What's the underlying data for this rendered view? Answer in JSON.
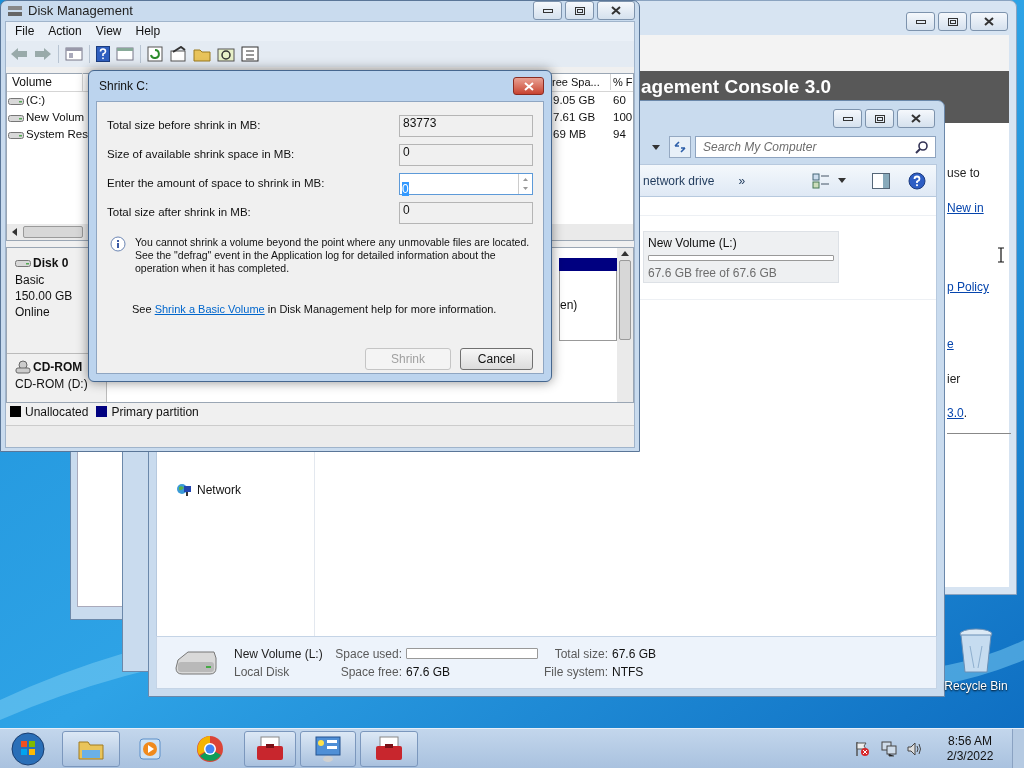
{
  "disk_management": {
    "title": "Disk Management",
    "menu": [
      "File",
      "Action",
      "View",
      "Help"
    ],
    "columns": [
      {
        "label": "Volume"
      },
      {
        "label": "ree Spa..."
      },
      {
        "label": "% F"
      }
    ],
    "volumes": [
      {
        "name": "(C:)",
        "free": "9.05 GB",
        "percent": "60"
      },
      {
        "name": "New Volum",
        "free": "7.61 GB",
        "percent": "100"
      },
      {
        "name": "System Res",
        "free": "69 MB",
        "percent": "94"
      }
    ],
    "disks": [
      {
        "kind": "disk",
        "name": "Disk 0",
        "lines": [
          "Basic",
          "150.00 GB",
          "Online"
        ]
      },
      {
        "kind": "cdrom",
        "name": "CD-ROM",
        "lines": [
          "CD-ROM (D:)"
        ]
      }
    ],
    "partition_label": "en)",
    "legend": [
      {
        "label": "Unallocated",
        "color": "#000000"
      },
      {
        "label": "Primary partition",
        "color": "#000080"
      }
    ]
  },
  "shrink_dialog": {
    "title": "Shrink C:",
    "fields": [
      {
        "label": "Total size before shrink in MB:",
        "value": "83773",
        "kind": "readonly"
      },
      {
        "label": "Size of available shrink space in MB:",
        "value": "0",
        "kind": "readonly"
      },
      {
        "label": "Enter the amount of space to shrink in MB:",
        "value": "0",
        "kind": "spin",
        "text_selected": true
      },
      {
        "label": "Total size after shrink in MB:",
        "value": "0",
        "kind": "readonly"
      }
    ],
    "info": "You cannot shrink a volume beyond the point where any unmovable files are located. See the \"defrag\" event in the Application log for detailed information about the operation when it has completed.",
    "help": {
      "before": "See",
      "link": "Shrink a Basic Volume",
      "after": "in Disk Management help for more information."
    },
    "buttons": [
      {
        "label": "Shrink",
        "disabled": true
      },
      {
        "label": "Cancel",
        "disabled": false
      }
    ]
  },
  "explorer": {
    "search_placeholder": "Search My Computer",
    "toolbar": [
      "network drive",
      "»"
    ],
    "drive": {
      "name": "New Volume (L:)",
      "free": "67.6 GB free of 67.6 GB",
      "level": 0
    },
    "nav": [
      "Network"
    ],
    "details": {
      "name": "New Volume (L:)",
      "type": "Local Disk",
      "space_used": {
        "label": "Space used:",
        "level": 0
      },
      "free_label": "Space free:",
      "free_value": "67.6 GB",
      "total_label": "Total size:",
      "total_value": "67.6 GB",
      "fs_label": "File system:",
      "fs_value": "NTFS"
    }
  },
  "console": {
    "heading": "agement Console 3.0",
    "lines": [
      {
        "parts": [
          {
            "text": "use to",
            "link": false
          }
        ]
      },
      {
        "parts": [
          {
            "text": "New in",
            "link": true
          }
        ]
      },
      {
        "parts": [
          {
            "text": "p Policy",
            "link": true
          }
        ]
      },
      {
        "parts": [
          {
            "text": "e",
            "link": true
          }
        ]
      },
      {
        "parts": [
          {
            "text": "ier",
            "link": false
          }
        ]
      },
      {
        "parts": [
          {
            "text": "3.0",
            "link": true
          },
          {
            "text": ".",
            "link": false
          }
        ]
      }
    ]
  },
  "desktop": {
    "icons": [
      {
        "label": "Recycle Bin"
      }
    ]
  },
  "taskbar": {
    "time": "8:56 AM",
    "date": "2/3/2022"
  }
}
